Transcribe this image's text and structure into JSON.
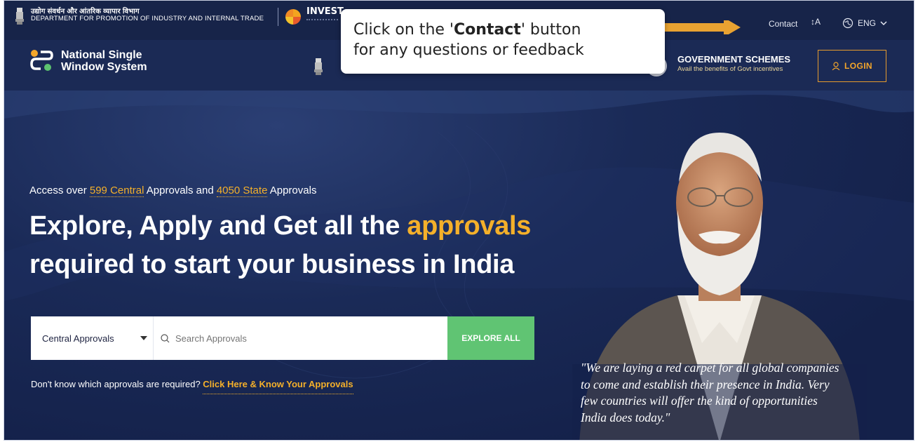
{
  "header": {
    "dept_hindi": "उद्योग संवर्धन और आंतरिक व्यापार विभाग",
    "dept_english": "DEPARTMENT FOR PROMOTION OF INDUSTRY AND INTERNAL TRADE",
    "invest_logo_text": "INVEST",
    "contact": "Contact",
    "text_size": "↕A",
    "language": "ENG"
  },
  "nav": {
    "brand_line1": "National Single",
    "brand_line2": "Window System",
    "schemes_title": "GOVERNMENT SCHEMES",
    "schemes_sub": "Avail the benefits of Govt incentives",
    "login": "LOGIN"
  },
  "tooltip": {
    "pre": "Click on the '",
    "bold": "Contact",
    "post": "' button",
    "line2": "for any questions or feedback"
  },
  "hero": {
    "access_pre": "Access over ",
    "central_count": "599 Central",
    "access_mid": " Approvals and ",
    "state_count": "4050 State",
    "access_post": " Approvals",
    "headline_pre": "Explore, Apply and Get all the ",
    "headline_hl": "approvals",
    "headline_line2": "required to start your business in India",
    "select_value": "Central Approvals",
    "search_placeholder": "Search Approvals",
    "explore_btn": "EXPLORE ALL",
    "know_pre": "Don't know which approvals are required? ",
    "know_link": "Click Here & Know Your Approvals",
    "quote_line1": "\"We are laying a red carpet for all global companies",
    "quote_line2": "to come and establish their presence in India. Very",
    "quote_line3": "few countries will offer the kind of opportunities",
    "quote_line4": "India does today.\""
  },
  "colors": {
    "accent": "#f4b02a",
    "explore_green": "#60c473",
    "navy": "#172449"
  }
}
